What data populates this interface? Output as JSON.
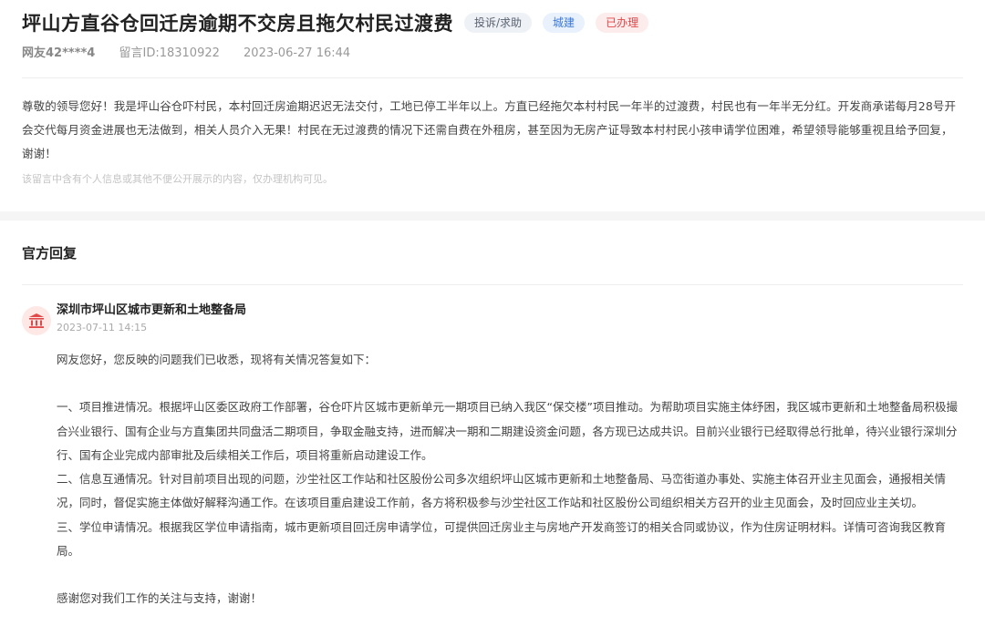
{
  "post": {
    "title": "坪山方直谷仓回迁房逾期不交房且拖欠村民过渡费",
    "tags": [
      "投诉/求助",
      "城建",
      "已办理"
    ],
    "user": "网友42****4",
    "message_id": "留言ID:18310922",
    "time": "2023-06-27 16:44",
    "content": "尊敬的领导您好！我是坪山谷仓吓村民，本村回迁房逾期迟迟无法交付，工地已停工半年以上。方直已经拖欠本村村民一年半的过渡费，村民也有一年半无分红。开发商承诺每月28号开会交代每月资金进展也无法做到，相关人员介入无果！村民在无过渡费的情况下还需自费在外租房，甚至因为无房产证导致本村村民小孩申请学位困难，希望领导能够重视且给予回复，谢谢！",
    "privacy_note": "该留言中含有个人信息或其他不便公开展示的内容，仅办理机构可见。"
  },
  "reply": {
    "section_title": "官方回复",
    "org": "深圳市坪山区城市更新和土地整备局",
    "time": "2023-07-11 14:15",
    "greeting": "网友您好，您反映的问题我们已收悉，现将有关情况答复如下：",
    "item1": "一、项目推进情况。根据坪山区委区政府工作部署，谷仓吓片区城市更新单元一期项目已纳入我区“保交楼”项目推动。为帮助项目实施主体纾困，我区城市更新和土地整备局积极撮合兴业银行、国有企业与方直集团共同盘活二期项目，争取金融支持，进而解决一期和二期建设资金问题，各方现已达成共识。目前兴业银行已经取得总行批单，待兴业银行深圳分行、国有企业完成内部审批及后续相关工作后，项目将重新启动建设工作。",
    "item2": "二、信息互通情况。针对目前项目出现的问题，沙坣社区工作站和社区股份公司多次组织坪山区城市更新和土地整备局、马峦街道办事处、实施主体召开业主见面会，通报相关情况，同时，督促实施主体做好解释沟通工作。在该项目重启建设工作前，各方将积极参与沙坣社区工作站和社区股份公司组织相关方召开的业主见面会，及时回应业主关切。",
    "item3": "三、学位申请情况。根据我区学位申请指南，城市更新项目回迁房申请学位，可提供回迁房业主与房地产开发商签订的相关合同或协议，作为住房证明材料。详情可咨询我区教育局。",
    "closing": "感谢您对我们工作的关注与支持，谢谢！"
  },
  "icons": {
    "avatar": "government-building-icon"
  },
  "colors": {
    "avatar_bg": "#fde8e6",
    "avatar_icon": "#e0484a",
    "tag_red": "#e0484a",
    "tag_blue": "#3b78d8"
  }
}
